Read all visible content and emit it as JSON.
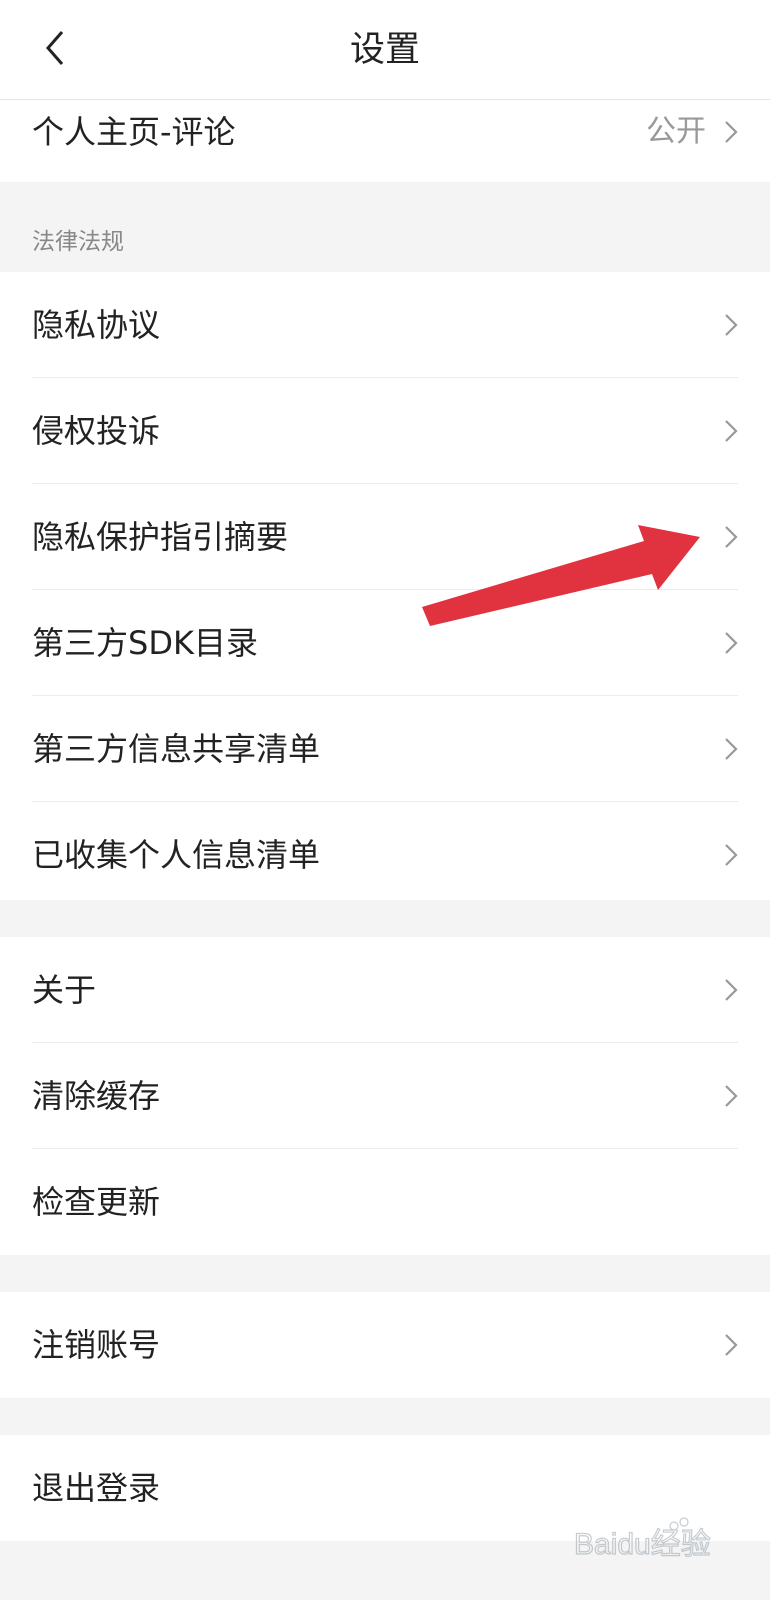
{
  "header": {
    "title": "设置"
  },
  "top_section": {
    "items": [
      {
        "label": "个人主页-评论",
        "value": "公开"
      }
    ]
  },
  "legal_section": {
    "title": "法律法规",
    "items": [
      {
        "label": "隐私协议"
      },
      {
        "label": "侵权投诉"
      },
      {
        "label": "隐私保护指引摘要"
      },
      {
        "label": "第三方SDK目录"
      },
      {
        "label": "第三方信息共享清单"
      },
      {
        "label": "已收集个人信息清单"
      }
    ]
  },
  "general_section": {
    "items": [
      {
        "label": "关于"
      },
      {
        "label": "清除缓存"
      },
      {
        "label": "检查更新"
      }
    ]
  },
  "account_section": {
    "items": [
      {
        "label": "注销账号"
      }
    ]
  },
  "logout_section": {
    "items": [
      {
        "label": "退出登录"
      }
    ]
  },
  "annotation": {
    "arrow_color": "#e0333f"
  },
  "watermark": {
    "text": "Baidu经验"
  }
}
